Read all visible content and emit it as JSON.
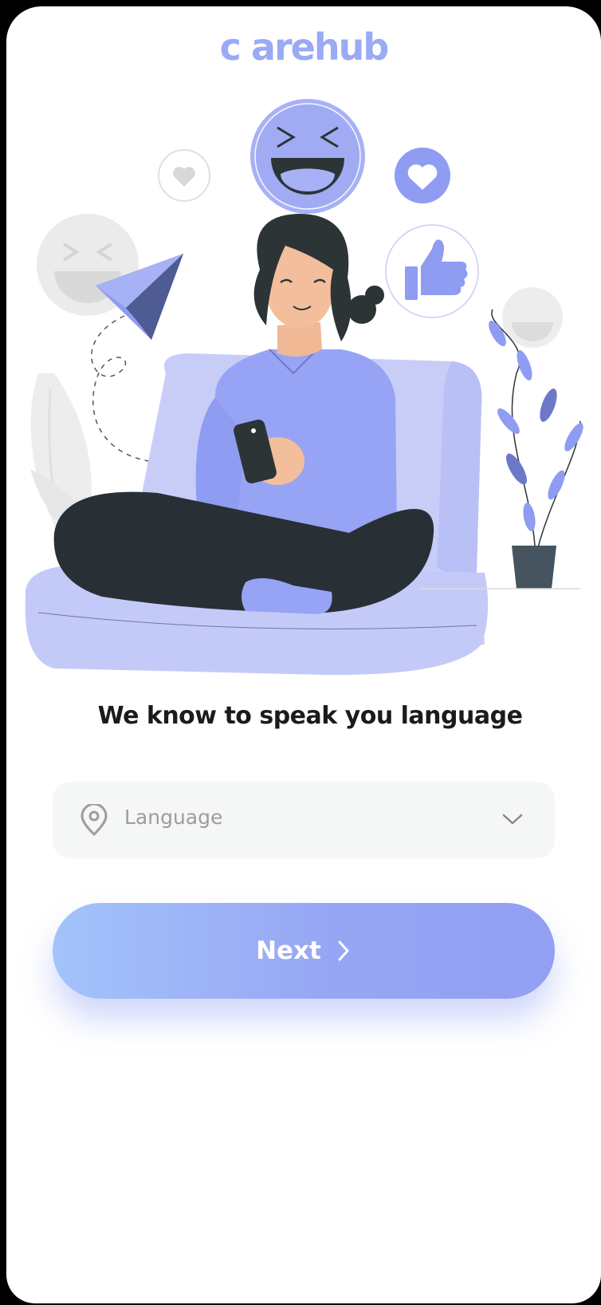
{
  "app": {
    "logo_text": "c arehub"
  },
  "onboarding": {
    "headline": "We know to speak you language",
    "illustration_icon": "woman-on-couch-with-phone-illustration"
  },
  "language_select": {
    "placeholder": "Language",
    "leading_icon": "location-pin-icon",
    "trailing_icon": "chevron-down-icon"
  },
  "next_button": {
    "label": "Next",
    "icon": "chevron-right-icon"
  },
  "colors": {
    "accent": "#97a6f4",
    "logo": "#9aaaf3",
    "gradient_start": "#a3c3fb",
    "gradient_end": "#929ff3",
    "field_bg": "#f5f6f6",
    "text_dark": "#1e1a1a",
    "placeholder": "#9d9d9d"
  }
}
